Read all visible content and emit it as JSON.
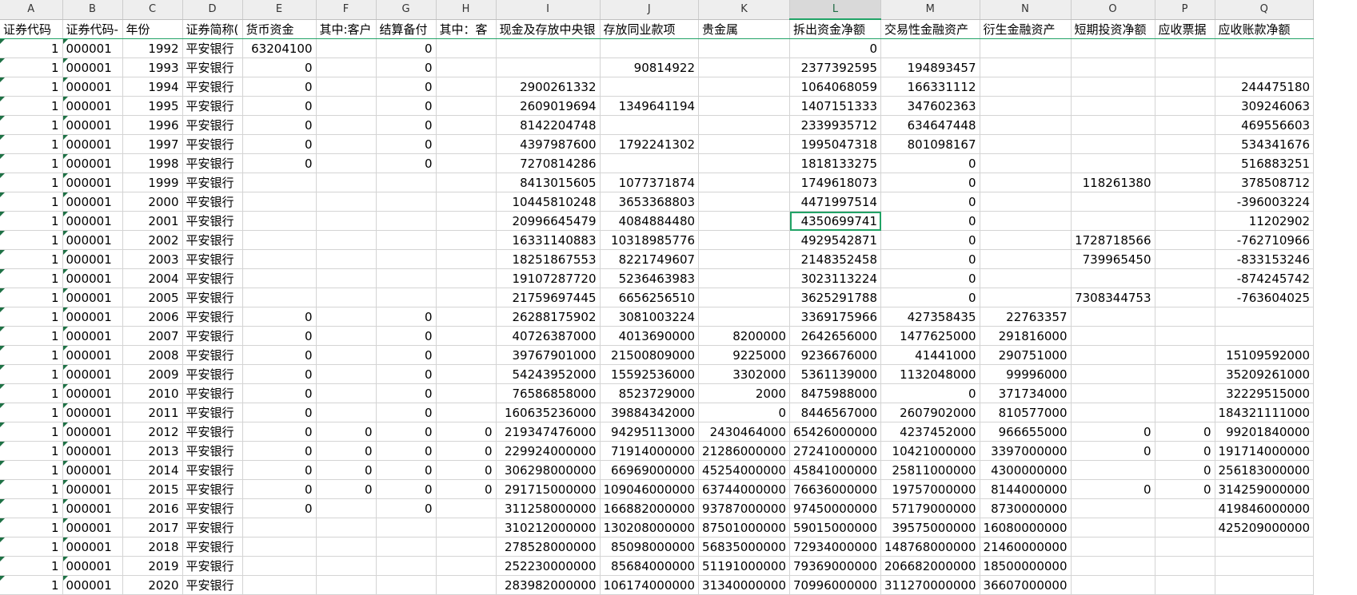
{
  "sheet": {
    "columns": [
      "A",
      "B",
      "C",
      "D",
      "E",
      "F",
      "G",
      "H",
      "I",
      "J",
      "K",
      "L",
      "M",
      "N",
      "O",
      "P",
      "Q"
    ],
    "selected_column": "L",
    "active_cell": {
      "row": 9,
      "col": 11
    },
    "header_row": [
      "证券代码",
      "证券代码-",
      "年份",
      "证券简称(",
      "货币资金",
      "其中:客户",
      "结算备付",
      "其中：客",
      "现金及存放中央银",
      "存放同业款项",
      "贵金属",
      "拆出资金净额",
      "交易性金融资产",
      "衍生金融资产",
      "短期投资净额",
      "应收票据",
      "应收账款净额"
    ],
    "rows": [
      [
        "1",
        "000001",
        "1992",
        "平安银行",
        "63204100",
        "",
        "0",
        "",
        "",
        "",
        "",
        "0",
        "",
        "",
        "",
        "",
        ""
      ],
      [
        "1",
        "000001",
        "1993",
        "平安银行",
        "0",
        "",
        "0",
        "",
        "",
        "90814922",
        "",
        "2377392595",
        "194893457",
        "",
        "",
        "",
        ""
      ],
      [
        "1",
        "000001",
        "1994",
        "平安银行",
        "0",
        "",
        "0",
        "",
        "2900261332",
        "",
        "",
        "1064068059",
        "166331112",
        "",
        "",
        "",
        "244475180"
      ],
      [
        "1",
        "000001",
        "1995",
        "平安银行",
        "0",
        "",
        "0",
        "",
        "2609019694",
        "1349641194",
        "",
        "1407151333",
        "347602363",
        "",
        "",
        "",
        "309246063"
      ],
      [
        "1",
        "000001",
        "1996",
        "平安银行",
        "0",
        "",
        "0",
        "",
        "8142204748",
        "",
        "",
        "2339935712",
        "634647448",
        "",
        "",
        "",
        "469556603"
      ],
      [
        "1",
        "000001",
        "1997",
        "平安银行",
        "0",
        "",
        "0",
        "",
        "4397987600",
        "1792241302",
        "",
        "1995047318",
        "801098167",
        "",
        "",
        "",
        "534341676"
      ],
      [
        "1",
        "000001",
        "1998",
        "平安银行",
        "0",
        "",
        "0",
        "",
        "7270814286",
        "",
        "",
        "1818133275",
        "0",
        "",
        "",
        "",
        "516883251"
      ],
      [
        "1",
        "000001",
        "1999",
        "平安银行",
        "",
        "",
        "",
        "",
        "8413015605",
        "1077371874",
        "",
        "1749618073",
        "0",
        "",
        "118261380",
        "",
        "378508712"
      ],
      [
        "1",
        "000001",
        "2000",
        "平安银行",
        "",
        "",
        "",
        "",
        "10445810248",
        "3653368803",
        "",
        "4471997514",
        "0",
        "",
        "",
        "",
        "-396003224"
      ],
      [
        "1",
        "000001",
        "2001",
        "平安银行",
        "",
        "",
        "",
        "",
        "20996645479",
        "4084884480",
        "",
        "4350699741",
        "0",
        "",
        "",
        "",
        "11202902"
      ],
      [
        "1",
        "000001",
        "2002",
        "平安银行",
        "",
        "",
        "",
        "",
        "16331140883",
        "10318985776",
        "",
        "4929542871",
        "0",
        "",
        "1728718566",
        "",
        "-762710966"
      ],
      [
        "1",
        "000001",
        "2003",
        "平安银行",
        "",
        "",
        "",
        "",
        "18251867553",
        "8221749607",
        "",
        "2148352458",
        "0",
        "",
        "739965450",
        "",
        "-833153246"
      ],
      [
        "1",
        "000001",
        "2004",
        "平安银行",
        "",
        "",
        "",
        "",
        "19107287720",
        "5236463983",
        "",
        "3023113224",
        "0",
        "",
        "",
        "",
        "-874245742"
      ],
      [
        "1",
        "000001",
        "2005",
        "平安银行",
        "",
        "",
        "",
        "",
        "21759697445",
        "6656256510",
        "",
        "3625291788",
        "0",
        "",
        "7308344753",
        "",
        "-763604025"
      ],
      [
        "1",
        "000001",
        "2006",
        "平安银行",
        "0",
        "",
        "0",
        "",
        "26288175902",
        "3081003224",
        "",
        "3369175966",
        "427358435",
        "22763357",
        "",
        "",
        ""
      ],
      [
        "1",
        "000001",
        "2007",
        "平安银行",
        "0",
        "",
        "0",
        "",
        "40726387000",
        "4013690000",
        "8200000",
        "2642656000",
        "1477625000",
        "291816000",
        "",
        "",
        ""
      ],
      [
        "1",
        "000001",
        "2008",
        "平安银行",
        "0",
        "",
        "0",
        "",
        "39767901000",
        "21500809000",
        "9225000",
        "9236676000",
        "41441000",
        "290751000",
        "",
        "",
        "15109592000"
      ],
      [
        "1",
        "000001",
        "2009",
        "平安银行",
        "0",
        "",
        "0",
        "",
        "54243952000",
        "15592536000",
        "3302000",
        "5361139000",
        "1132048000",
        "99996000",
        "",
        "",
        "35209261000"
      ],
      [
        "1",
        "000001",
        "2010",
        "平安银行",
        "0",
        "",
        "0",
        "",
        "76586858000",
        "8523729000",
        "2000",
        "8475988000",
        "0",
        "371734000",
        "",
        "",
        "32229515000"
      ],
      [
        "1",
        "000001",
        "2011",
        "平安银行",
        "0",
        "",
        "0",
        "",
        "160635236000",
        "39884342000",
        "0",
        "8446567000",
        "2607902000",
        "810577000",
        "",
        "",
        "184321111000"
      ],
      [
        "1",
        "000001",
        "2012",
        "平安银行",
        "0",
        "0",
        "0",
        "0",
        "219347476000",
        "94295113000",
        "2430464000",
        "65426000000",
        "4237452000",
        "966655000",
        "0",
        "0",
        "99201840000"
      ],
      [
        "1",
        "000001",
        "2013",
        "平安银行",
        "0",
        "0",
        "0",
        "0",
        "229924000000",
        "71914000000",
        "21286000000",
        "27241000000",
        "10421000000",
        "3397000000",
        "0",
        "0",
        "191714000000"
      ],
      [
        "1",
        "000001",
        "2014",
        "平安银行",
        "0",
        "0",
        "0",
        "0",
        "306298000000",
        "66969000000",
        "45254000000",
        "45841000000",
        "25811000000",
        "4300000000",
        "",
        "0",
        "256183000000"
      ],
      [
        "1",
        "000001",
        "2015",
        "平安银行",
        "0",
        "0",
        "0",
        "0",
        "291715000000",
        "109046000000",
        "63744000000",
        "76636000000",
        "19757000000",
        "8144000000",
        "0",
        "0",
        "314259000000"
      ],
      [
        "1",
        "000001",
        "2016",
        "平安银行",
        "0",
        "",
        "0",
        "",
        "311258000000",
        "166882000000",
        "93787000000",
        "97450000000",
        "57179000000",
        "8730000000",
        "",
        "",
        "419846000000"
      ],
      [
        "1",
        "000001",
        "2017",
        "平安银行",
        "",
        "",
        "",
        "",
        "310212000000",
        "130208000000",
        "87501000000",
        "59015000000",
        "39575000000",
        "16080000000",
        "",
        "",
        "425209000000"
      ],
      [
        "1",
        "000001",
        "2018",
        "平安银行",
        "",
        "",
        "",
        "",
        "278528000000",
        "85098000000",
        "56835000000",
        "72934000000",
        "148768000000",
        "21460000000",
        "",
        "",
        ""
      ],
      [
        "1",
        "000001",
        "2019",
        "平安银行",
        "",
        "",
        "",
        "",
        "252230000000",
        "85684000000",
        "51191000000",
        "79369000000",
        "206682000000",
        "18500000000",
        "",
        "",
        ""
      ],
      [
        "1",
        "000001",
        "2020",
        "平安银行",
        "",
        "",
        "",
        "",
        "283982000000",
        "106174000000",
        "31340000000",
        "70996000000",
        "311270000000",
        "36607000000",
        "",
        "",
        ""
      ]
    ]
  }
}
